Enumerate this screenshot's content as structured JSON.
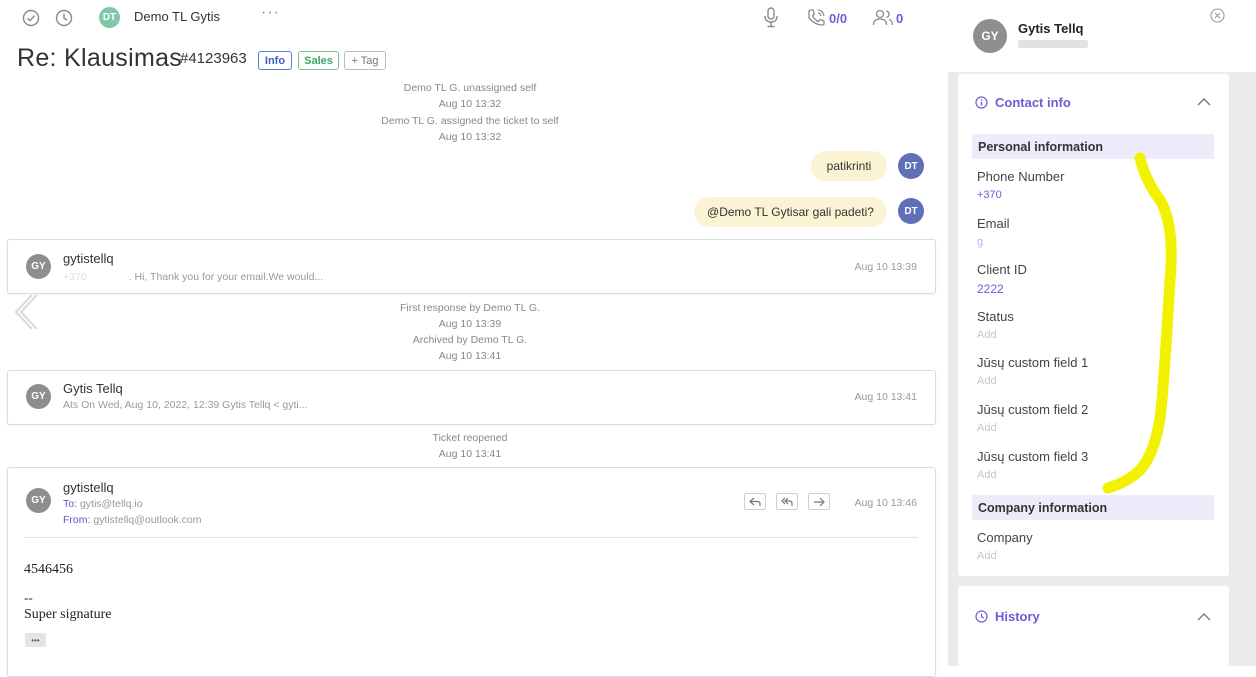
{
  "toolbar": {
    "agent_initials": "DT",
    "agent_name": "Demo TL Gytis",
    "more": "···",
    "calls_count": "0/0",
    "participants_count": "0"
  },
  "ticket": {
    "title": "Re: Klausimas",
    "number": "#4123963",
    "tags": [
      "Info",
      "Sales"
    ],
    "add_tag": "+ Tag"
  },
  "timeline": {
    "events_top": [
      "Demo TL G. unassigned self",
      "Aug 10 13:32",
      "Demo TL G. assigned the ticket to self",
      "Aug 10 13:32"
    ],
    "notes": [
      {
        "text": "patikrinti",
        "initials": "DT"
      },
      {
        "mention": "@Demo TL Gytis",
        "rest": " ar gali padeti?",
        "initials": "DT"
      }
    ],
    "message1": {
      "initials": "GY",
      "name": "gytistellq",
      "prefix": "+370",
      "snippet": ". Hi, Thank you for your email.We would...",
      "time": "Aug 10 13:39"
    },
    "events_mid": [
      "First response by Demo TL G.",
      "Aug 10 13:39",
      "Archived by Demo TL G.",
      "Aug 10 13:41"
    ],
    "message2": {
      "initials": "GY",
      "name": "Gytis Tellq",
      "snippet": "Ats On Wed, Aug 10, 2022, 12:39 Gytis Tellq < gyti...",
      "time": "Aug 10 13:41"
    },
    "events_reopen": [
      "Ticket reopened",
      "Aug 10 13:41"
    ],
    "email": {
      "initials": "GY",
      "name": "gytistellq",
      "to_label": "To:",
      "to": "gytis@tellq.io",
      "from_label": "From:",
      "from": "gytistellq@outlook.com",
      "time": "Aug 10 13:46",
      "body": "4546456",
      "sig_sep": "--",
      "signature": "Super signature",
      "expand": "•••"
    }
  },
  "contact": {
    "initials": "GY",
    "name": "Gytis Tellq",
    "section_title": "Contact info",
    "personal_header": "Personal information",
    "fields": [
      {
        "label": "Phone Number",
        "value": "+370"
      },
      {
        "label": "Email",
        "value": "g"
      },
      {
        "label": "Client ID",
        "value": "2222"
      },
      {
        "label": "Status",
        "value": "Add"
      },
      {
        "label": "Jūsų custom field 1",
        "value": "Add"
      },
      {
        "label": "Jūsų custom field 2",
        "value": "Add"
      },
      {
        "label": "Jūsų custom field 3",
        "value": "Add"
      }
    ],
    "company_header": "Company information",
    "company_field": {
      "label": "Company",
      "value": "Add"
    },
    "history_title": "History"
  },
  "colors": {
    "accent": "#6d5dd3",
    "note_bubble": "#fbf3d3",
    "panel_bg": "#ebebeb",
    "highlight": "#f2f200"
  },
  "icons": [
    "check-circle-icon",
    "clock-icon",
    "microphone-icon",
    "phone-icon",
    "users-icon",
    "close-icon",
    "info-icon",
    "chevron-up-icon",
    "history-icon",
    "reply-icon",
    "reply-all-icon",
    "forward-icon",
    "chevron-left-icon"
  ]
}
